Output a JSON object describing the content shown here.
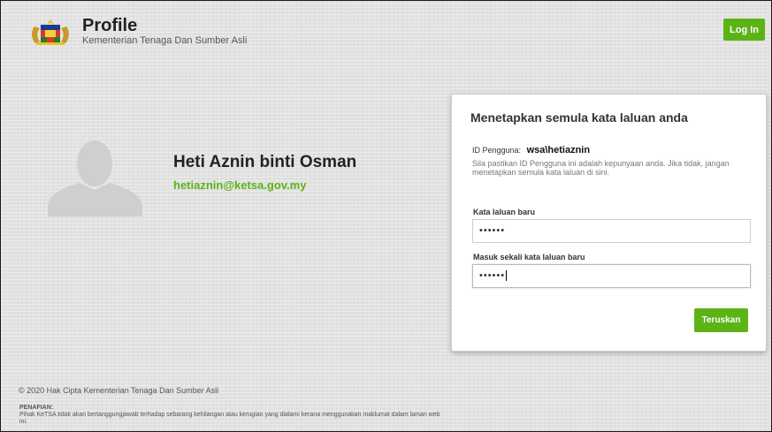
{
  "header": {
    "title": "Profile",
    "subtitle": "Kementerian Tenaga Dan Sumber Asli",
    "login_label": "Log In",
    "logo_icon": "malaysia-coat-of-arms-icon"
  },
  "profile": {
    "avatar_icon": "user-silhouette-icon",
    "name": "Heti Aznin binti Osman",
    "email": "hetiaznin@ketsa.gov.my"
  },
  "reset_card": {
    "title": "Menetapkan semula kata laluan anda",
    "id_label": "ID Pengguna:",
    "id_value": "wsa\\hetiaznin",
    "note": "Sila pastikan ID Pengguna ini adalah kepunyaan anda. Jika tidak, jangan menetapkan semula kata laluan di sini.",
    "new_password_label": "Kata laluan baru",
    "new_password_value": "••••••",
    "confirm_password_label": "Masuk sekali kata laluan baru",
    "confirm_password_value": "••••••",
    "submit_label": "Teruskan"
  },
  "footer": {
    "copyright": "© 2020 Hak Cipta Kementerian Tenaga Dan Sumber Asli",
    "disclaimer_title": "PENAFIAN:",
    "disclaimer_text": "Pihak KeTSA tidak akan bertanggungjawab terhadap sebarang kehilangan atau kerugian yang dialami kerana menggunakan maklumat dalam laman web ini."
  },
  "colors": {
    "accent": "#5cb316",
    "background": "#e2e2e2"
  }
}
